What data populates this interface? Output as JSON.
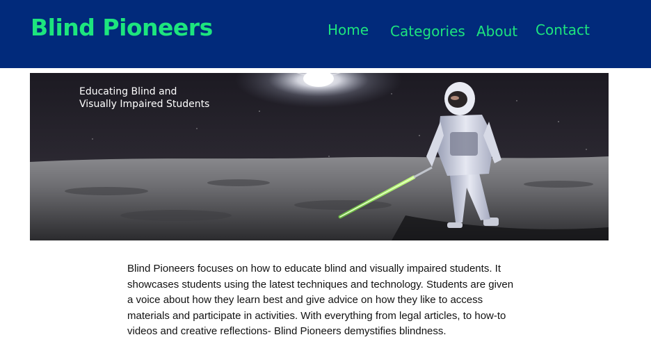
{
  "header": {
    "site_title": "Blind Pioneers",
    "nav": {
      "home": "Home",
      "categories": "Categories",
      "about": "About",
      "contact": "Contact"
    },
    "background_color": "#012a7b",
    "accent_color": "#1de57e"
  },
  "hero": {
    "caption_line1": "Educating Blind and",
    "caption_line2": "Visually Impaired Students"
  },
  "main": {
    "description": "Blind Pioneers focuses on how to educate blind and visually impaired students. It showcases students using the latest techniques and technology. Students are given a voice about how they learn best and give advice on how they like to access materials and participate in activities. With everything from legal articles, to how-to videos and creative reflections- Blind Pioneers demystifies blindness."
  }
}
